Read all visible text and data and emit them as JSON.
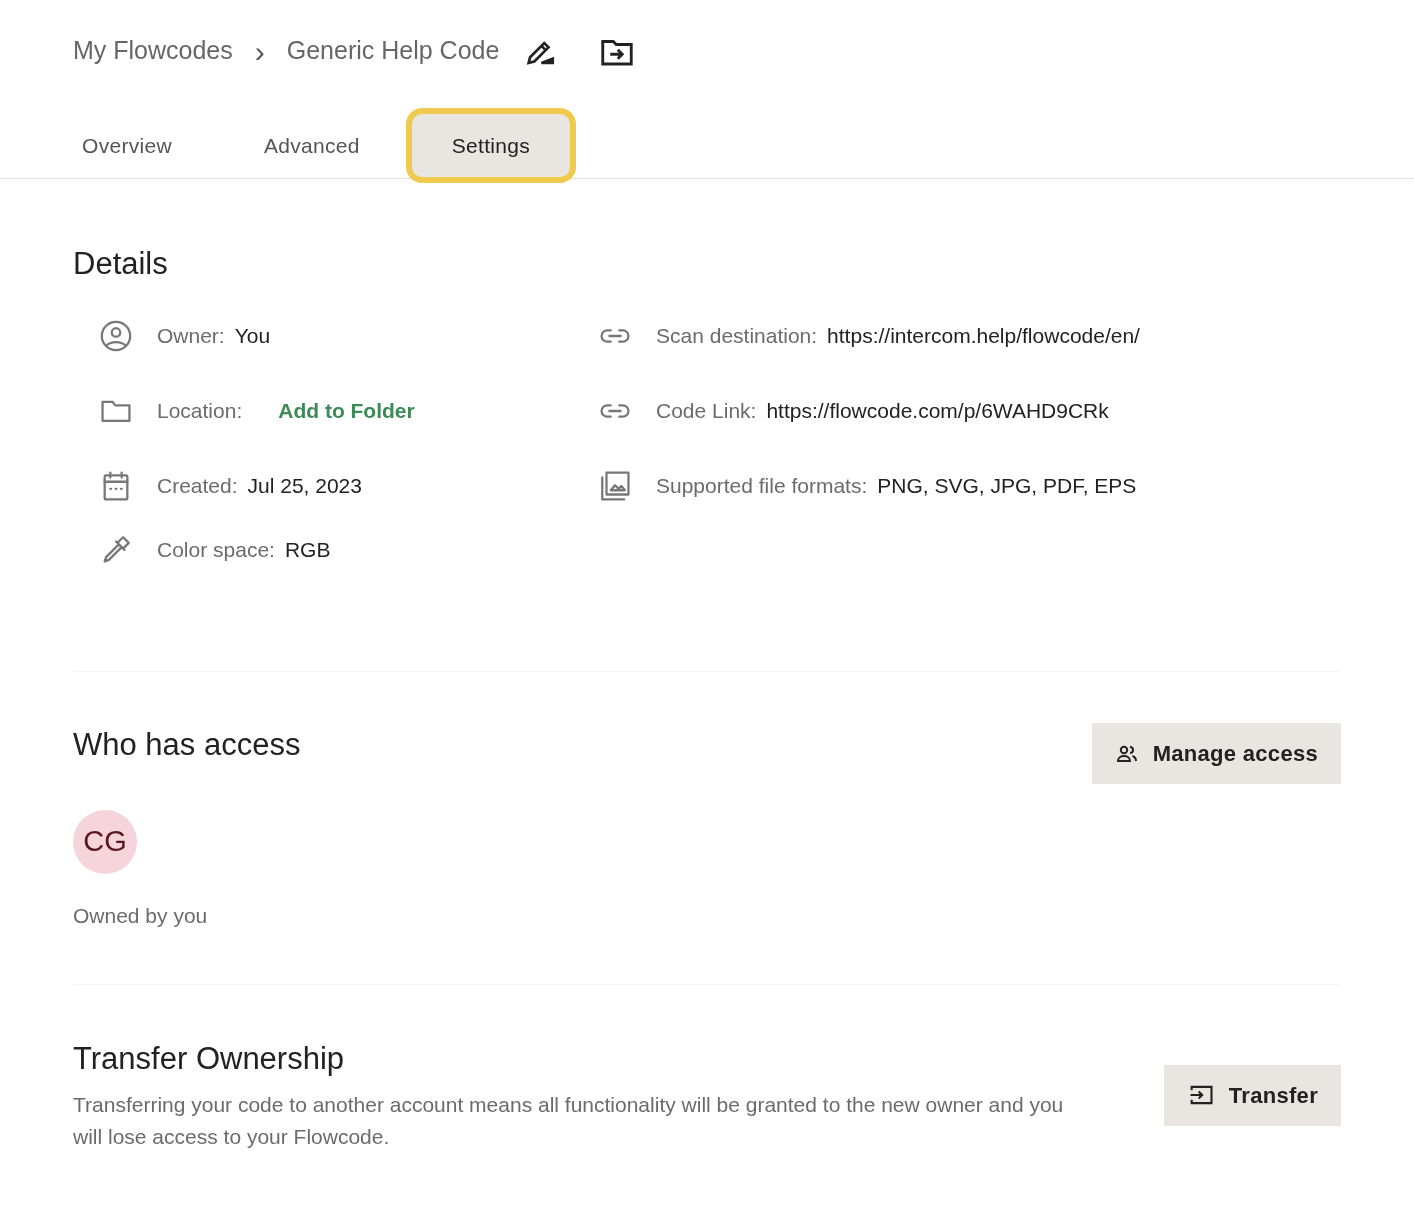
{
  "breadcrumb": {
    "parent": "My Flowcodes",
    "separator": "›",
    "current": "Generic Help Code"
  },
  "tabs": [
    {
      "label": "Overview",
      "selected": false
    },
    {
      "label": "Advanced",
      "selected": false
    },
    {
      "label": "Settings",
      "selected": true
    }
  ],
  "details": {
    "title": "Details",
    "left": [
      {
        "label": "Owner:",
        "value": "You",
        "kind": "text"
      },
      {
        "label": "Location:",
        "value": "Add to Folder",
        "kind": "link"
      },
      {
        "label": "Created:",
        "value": "Jul 25, 2023",
        "kind": "text"
      },
      {
        "label": "Color space:",
        "value": "RGB",
        "kind": "text"
      }
    ],
    "right": [
      {
        "label": "Scan destination:",
        "value": "https://intercom.help/flowcode/en/",
        "kind": "text"
      },
      {
        "label": "Code Link:",
        "value": "https://flowcode.com/p/6WAHD9CRk",
        "kind": "text"
      },
      {
        "label": "Supported file formats:",
        "value": "PNG, SVG, JPG, PDF, EPS",
        "kind": "text"
      }
    ]
  },
  "access": {
    "title": "Who has access",
    "button": "Manage access",
    "avatar_initials": "CG",
    "caption": "Owned by you"
  },
  "transfer": {
    "title": "Transfer Ownership",
    "description": "Transferring your code to another account means all functionality will be granted to the new owner and you will lose access to your Flowcode.",
    "button": "Transfer"
  }
}
